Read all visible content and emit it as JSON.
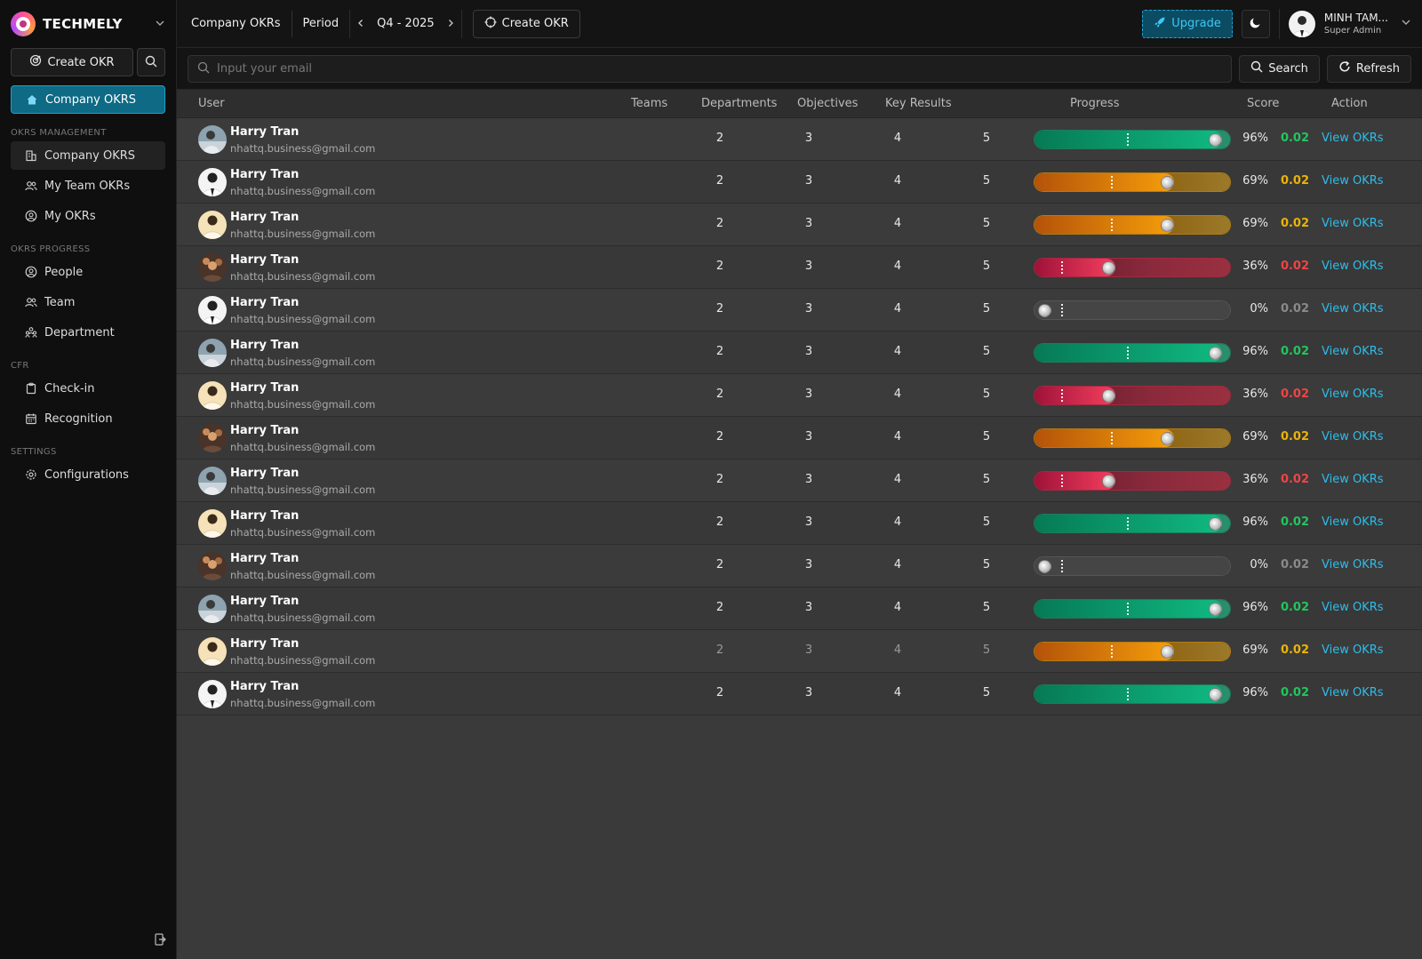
{
  "sidebar": {
    "brand": "TECHMELY",
    "create_label": "Create OKR",
    "active_item": "Company OKRS",
    "sections": [
      {
        "label": "OKRS MANAGEMENT",
        "items": [
          "Company OKRS",
          "My Team OKRs",
          "My OKRs"
        ]
      },
      {
        "label": "OKRS PROGRESS",
        "items": [
          "People",
          "Team",
          "Department"
        ]
      },
      {
        "label": "CFR",
        "items": [
          "Check-in",
          "Recognition"
        ]
      },
      {
        "label": "SETTINGS",
        "items": [
          "Configurations"
        ]
      }
    ]
  },
  "topbar": {
    "title": "Company OKRs",
    "period_label": "Period",
    "period_value": "Q4 - 2025",
    "create_label": "Create OKR",
    "upgrade_label": "Upgrade",
    "user_name": "MINH TAM...",
    "user_role": "Super Admin"
  },
  "search": {
    "placeholder": "Input your email",
    "search_label": "Search",
    "refresh_label": "Refresh"
  },
  "table": {
    "headers": [
      "User",
      "Teams",
      "Departments",
      "Objectives",
      "Key Results",
      "Progress",
      "Score",
      "Action"
    ],
    "rows": [
      {
        "name": "Harry Tran",
        "email": "nhattq.business@gmail.com",
        "teams": "2",
        "departments": "3",
        "objectives": "4",
        "key_results": "5",
        "progress": 96,
        "progress_label": "96%",
        "score": "0.02",
        "action": "View OKRs",
        "status": "green",
        "avatar": 0
      },
      {
        "name": "Harry Tran",
        "email": "nhattq.business@gmail.com",
        "teams": "2",
        "departments": "3",
        "objectives": "4",
        "key_results": "5",
        "progress": 69,
        "progress_label": "69%",
        "score": "0.02",
        "action": "View OKRs",
        "status": "orange",
        "avatar": 1
      },
      {
        "name": "Harry Tran",
        "email": "nhattq.business@gmail.com",
        "teams": "2",
        "departments": "3",
        "objectives": "4",
        "key_results": "5",
        "progress": 69,
        "progress_label": "69%",
        "score": "0.02",
        "action": "View OKRs",
        "status": "orange",
        "avatar": 2
      },
      {
        "name": "Harry Tran",
        "email": "nhattq.business@gmail.com",
        "teams": "2",
        "departments": "3",
        "objectives": "4",
        "key_results": "5",
        "progress": 36,
        "progress_label": "36%",
        "score": "0.02",
        "action": "View OKRs",
        "status": "red",
        "avatar": 3
      },
      {
        "name": "Harry Tran",
        "email": "nhattq.business@gmail.com",
        "teams": "2",
        "departments": "3",
        "objectives": "4",
        "key_results": "5",
        "progress": 0,
        "progress_label": "0%",
        "score": "0.02",
        "action": "View OKRs",
        "status": "gray",
        "avatar": 1
      },
      {
        "name": "Harry Tran",
        "email": "nhattq.business@gmail.com",
        "teams": "2",
        "departments": "3",
        "objectives": "4",
        "key_results": "5",
        "progress": 96,
        "progress_label": "96%",
        "score": "0.02",
        "action": "View OKRs",
        "status": "green",
        "avatar": 0
      },
      {
        "name": "Harry Tran",
        "email": "nhattq.business@gmail.com",
        "teams": "2",
        "departments": "3",
        "objectives": "4",
        "key_results": "5",
        "progress": 36,
        "progress_label": "36%",
        "score": "0.02",
        "action": "View OKRs",
        "status": "red",
        "avatar": 2
      },
      {
        "name": "Harry Tran",
        "email": "nhattq.business@gmail.com",
        "teams": "2",
        "departments": "3",
        "objectives": "4",
        "key_results": "5",
        "progress": 69,
        "progress_label": "69%",
        "score": "0.02",
        "action": "View OKRs",
        "status": "orange",
        "avatar": 3
      },
      {
        "name": "Harry Tran",
        "email": "nhattq.business@gmail.com",
        "teams": "2",
        "departments": "3",
        "objectives": "4",
        "key_results": "5",
        "progress": 36,
        "progress_label": "36%",
        "score": "0.02",
        "action": "View OKRs",
        "status": "red",
        "avatar": 0
      },
      {
        "name": "Harry Tran",
        "email": "nhattq.business@gmail.com",
        "teams": "2",
        "departments": "3",
        "objectives": "4",
        "key_results": "5",
        "progress": 96,
        "progress_label": "96%",
        "score": "0.02",
        "action": "View OKRs",
        "status": "green",
        "avatar": 2
      },
      {
        "name": "Harry Tran",
        "email": "nhattq.business@gmail.com",
        "teams": "2",
        "departments": "3",
        "objectives": "4",
        "key_results": "5",
        "progress": 0,
        "progress_label": "0%",
        "score": "0.02",
        "action": "View OKRs",
        "status": "gray",
        "avatar": 3
      },
      {
        "name": "Harry Tran",
        "email": "nhattq.business@gmail.com",
        "teams": "2",
        "departments": "3",
        "objectives": "4",
        "key_results": "5",
        "progress": 96,
        "progress_label": "96%",
        "score": "0.02",
        "action": "View OKRs",
        "status": "green",
        "avatar": 0
      },
      {
        "name": "Harry Tran",
        "email": "nhattq.business@gmail.com",
        "teams": "2",
        "departments": "3",
        "objectives": "4",
        "key_results": "5",
        "progress": 69,
        "progress_label": "69%",
        "score": "0.02",
        "action": "View OKRs",
        "status": "orange",
        "avatar": 2,
        "dim": true
      },
      {
        "name": "Harry Tran",
        "email": "nhattq.business@gmail.com",
        "teams": "2",
        "departments": "3",
        "objectives": "4",
        "key_results": "5",
        "progress": 96,
        "progress_label": "96%",
        "score": "0.02",
        "action": "View OKRs",
        "status": "green",
        "avatar": 1
      }
    ]
  },
  "colors": {
    "accent": "#17a3c7",
    "green": "#16a34a",
    "orange": "#eab308",
    "red": "#ef4444",
    "gray": "#888888",
    "link": "#2fbde8"
  },
  "icons": [
    "chevron-down-icon",
    "target-icon",
    "search-icon",
    "home-icon",
    "building-icon",
    "team-icon",
    "user-circle-icon",
    "people-icon",
    "department-icon",
    "clipboard-icon",
    "calendar-icon",
    "gear-icon",
    "logout-icon",
    "chevron-left-icon",
    "chevron-right-icon",
    "crosshair-icon",
    "rocket-icon",
    "moon-icon",
    "refresh-icon"
  ]
}
